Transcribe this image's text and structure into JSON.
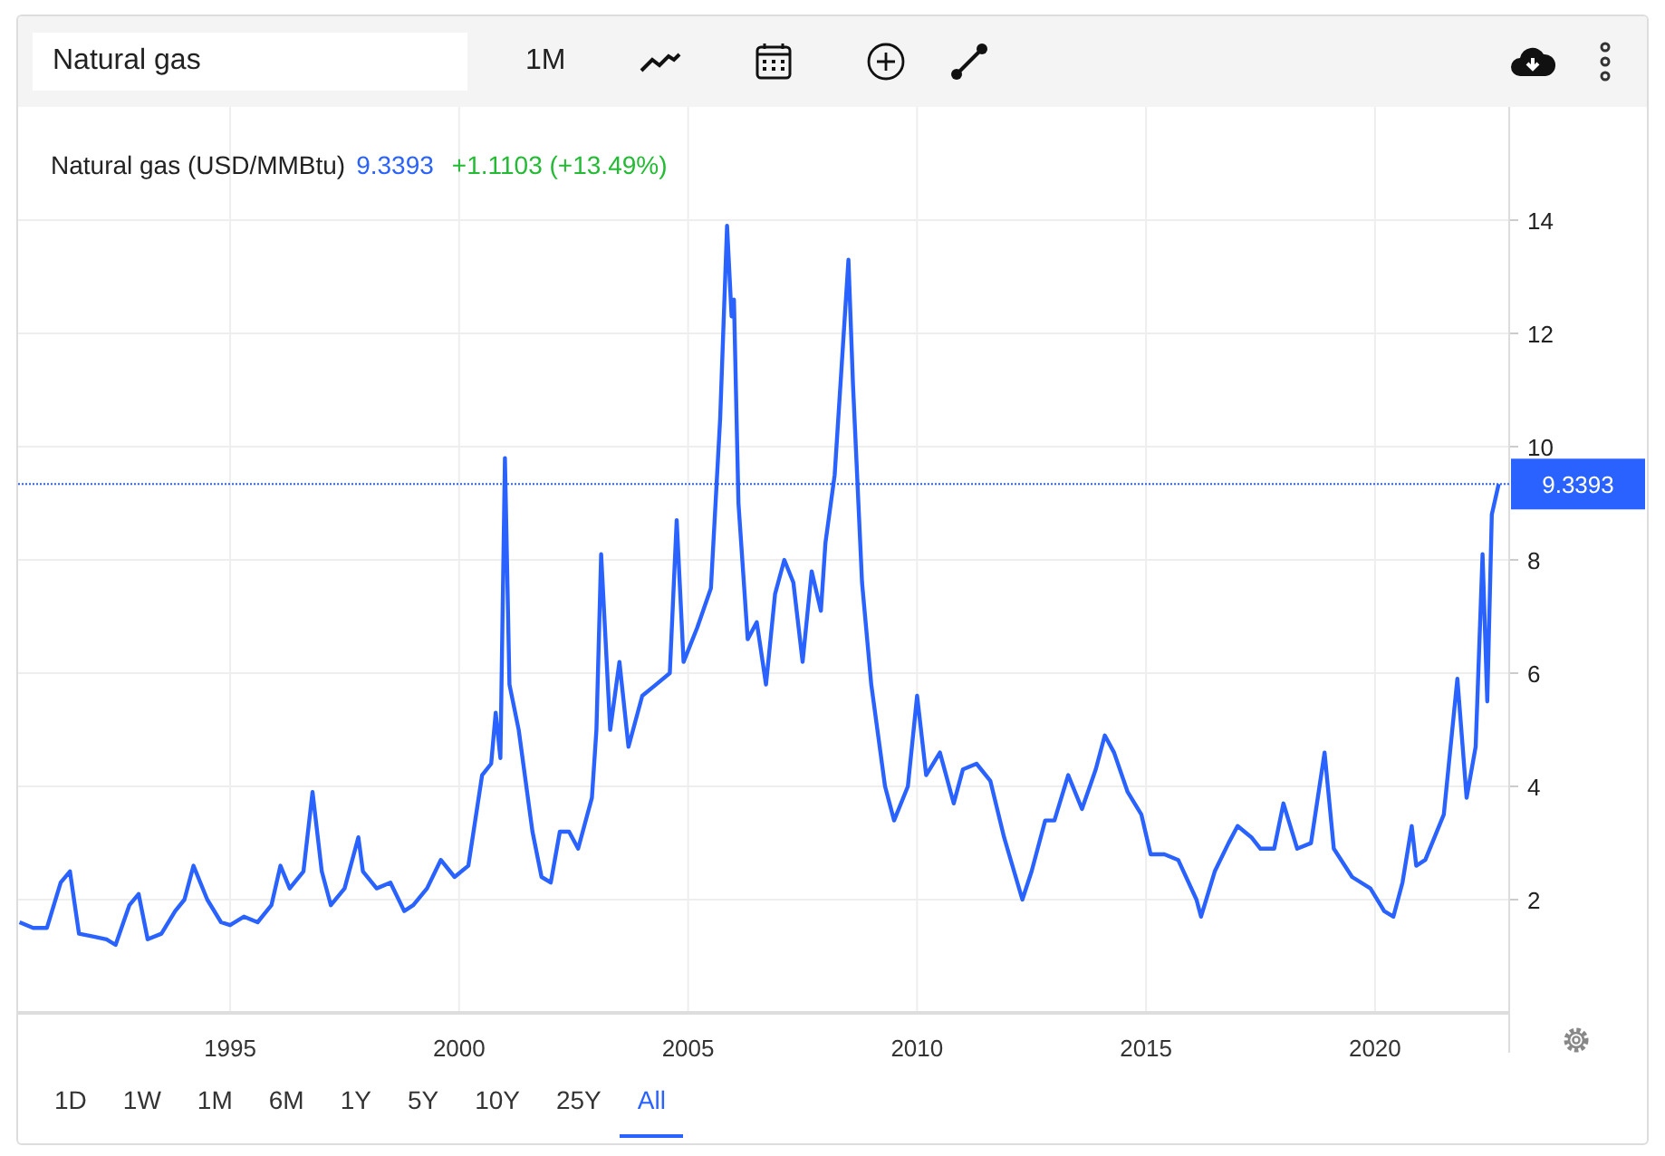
{
  "toolbar": {
    "search": {
      "value": "Natural gas"
    },
    "interval": "1M"
  },
  "legend": {
    "name": "Natural gas (USD/MMBtu)",
    "price": "9.3393",
    "change": "+1.1103 (+13.49%)"
  },
  "chart_data": {
    "type": "line",
    "xlim": [
      1990.37,
      2022.93
    ],
    "ylim": [
      0,
      16
    ],
    "xticks": [
      1995,
      2000,
      2005,
      2010,
      2015,
      2020
    ],
    "yticks": [
      2,
      4,
      6,
      8,
      10,
      12,
      14
    ],
    "x": [
      1990.4,
      1990.7,
      1991.0,
      1991.3,
      1991.5,
      1991.7,
      1992.0,
      1992.3,
      1992.5,
      1992.8,
      1993.0,
      1993.2,
      1993.5,
      1993.8,
      1994.0,
      1994.2,
      1994.5,
      1994.8,
      1995.0,
      1995.3,
      1995.6,
      1995.9,
      1996.1,
      1996.3,
      1996.6,
      1996.8,
      1997.0,
      1997.2,
      1997.5,
      1997.8,
      1997.9,
      1998.2,
      1998.5,
      1998.8,
      1999.0,
      1999.3,
      1999.6,
      1999.9,
      2000.2,
      2000.5,
      2000.7,
      2000.8,
      2000.9,
      2001.0,
      2001.1,
      2001.3,
      2001.6,
      2001.8,
      2002.0,
      2002.2,
      2002.4,
      2002.6,
      2002.9,
      2003.0,
      2003.1,
      2003.3,
      2003.5,
      2003.7,
      2004.0,
      2004.3,
      2004.6,
      2004.75,
      2004.9,
      2005.2,
      2005.5,
      2005.7,
      2005.85,
      2005.95,
      2006.0,
      2006.1,
      2006.3,
      2006.5,
      2006.7,
      2006.9,
      2007.1,
      2007.3,
      2007.5,
      2007.7,
      2007.9,
      2008.0,
      2008.2,
      2008.5,
      2008.6,
      2008.8,
      2009.0,
      2009.3,
      2009.5,
      2009.8,
      2010.0,
      2010.2,
      2010.5,
      2010.8,
      2011.0,
      2011.3,
      2011.6,
      2011.9,
      2012.3,
      2012.5,
      2012.8,
      2013.0,
      2013.3,
      2013.6,
      2013.9,
      2014.1,
      2014.3,
      2014.6,
      2014.9,
      2015.1,
      2015.4,
      2015.7,
      2016.1,
      2016.2,
      2016.5,
      2016.8,
      2017.0,
      2017.3,
      2017.5,
      2017.8,
      2018.0,
      2018.3,
      2018.6,
      2018.9,
      2019.1,
      2019.5,
      2019.9,
      2020.2,
      2020.4,
      2020.6,
      2020.8,
      2020.9,
      2021.1,
      2021.5,
      2021.8,
      2022.0,
      2022.2,
      2022.35,
      2022.45,
      2022.55,
      2022.7
    ],
    "grid": true,
    "series": [
      {
        "color": "#2962ff",
        "values": [
          1.6,
          1.5,
          1.5,
          2.3,
          2.5,
          1.4,
          1.35,
          1.3,
          1.2,
          1.9,
          2.1,
          1.3,
          1.4,
          1.8,
          2.0,
          2.6,
          2.0,
          1.6,
          1.55,
          1.7,
          1.6,
          1.9,
          2.6,
          2.2,
          2.5,
          3.9,
          2.5,
          1.9,
          2.2,
          3.1,
          2.5,
          2.2,
          2.3,
          1.8,
          1.9,
          2.2,
          2.7,
          2.4,
          2.6,
          4.2,
          4.4,
          5.3,
          4.5,
          9.8,
          5.8,
          5.0,
          3.2,
          2.4,
          2.3,
          3.2,
          3.2,
          2.9,
          3.8,
          5.0,
          8.1,
          5.0,
          6.2,
          4.7,
          5.6,
          5.8,
          6.0,
          8.7,
          6.2,
          6.8,
          7.5,
          10.5,
          13.9,
          12.3,
          12.6,
          9.0,
          6.6,
          6.9,
          5.8,
          7.4,
          8.0,
          7.6,
          6.2,
          7.8,
          7.1,
          8.3,
          9.5,
          13.3,
          11.1,
          7.6,
          5.8,
          4.0,
          3.4,
          4.0,
          5.6,
          4.2,
          4.6,
          3.7,
          4.3,
          4.4,
          4.1,
          3.1,
          2.0,
          2.5,
          3.4,
          3.4,
          4.2,
          3.6,
          4.3,
          4.9,
          4.6,
          3.9,
          3.5,
          2.8,
          2.8,
          2.7,
          2.0,
          1.7,
          2.5,
          3.0,
          3.3,
          3.1,
          2.9,
          2.9,
          3.7,
          2.9,
          3.0,
          4.6,
          2.9,
          2.4,
          2.2,
          1.8,
          1.7,
          2.3,
          3.3,
          2.6,
          2.7,
          3.5,
          5.9,
          3.8,
          4.7,
          8.1,
          5.5,
          8.8,
          9.34
        ]
      }
    ],
    "ref_lines": [
      {
        "axis": "y",
        "value": 9.3393,
        "label": "9.3393",
        "color": "#2962ff"
      }
    ]
  },
  "ranges": [
    {
      "label": "1D",
      "selected": false
    },
    {
      "label": "1W",
      "selected": false
    },
    {
      "label": "1M",
      "selected": false
    },
    {
      "label": "6M",
      "selected": false
    },
    {
      "label": "1Y",
      "selected": false
    },
    {
      "label": "5Y",
      "selected": false
    },
    {
      "label": "10Y",
      "selected": false
    },
    {
      "label": "25Y",
      "selected": false
    },
    {
      "label": "All",
      "selected": true
    }
  ]
}
